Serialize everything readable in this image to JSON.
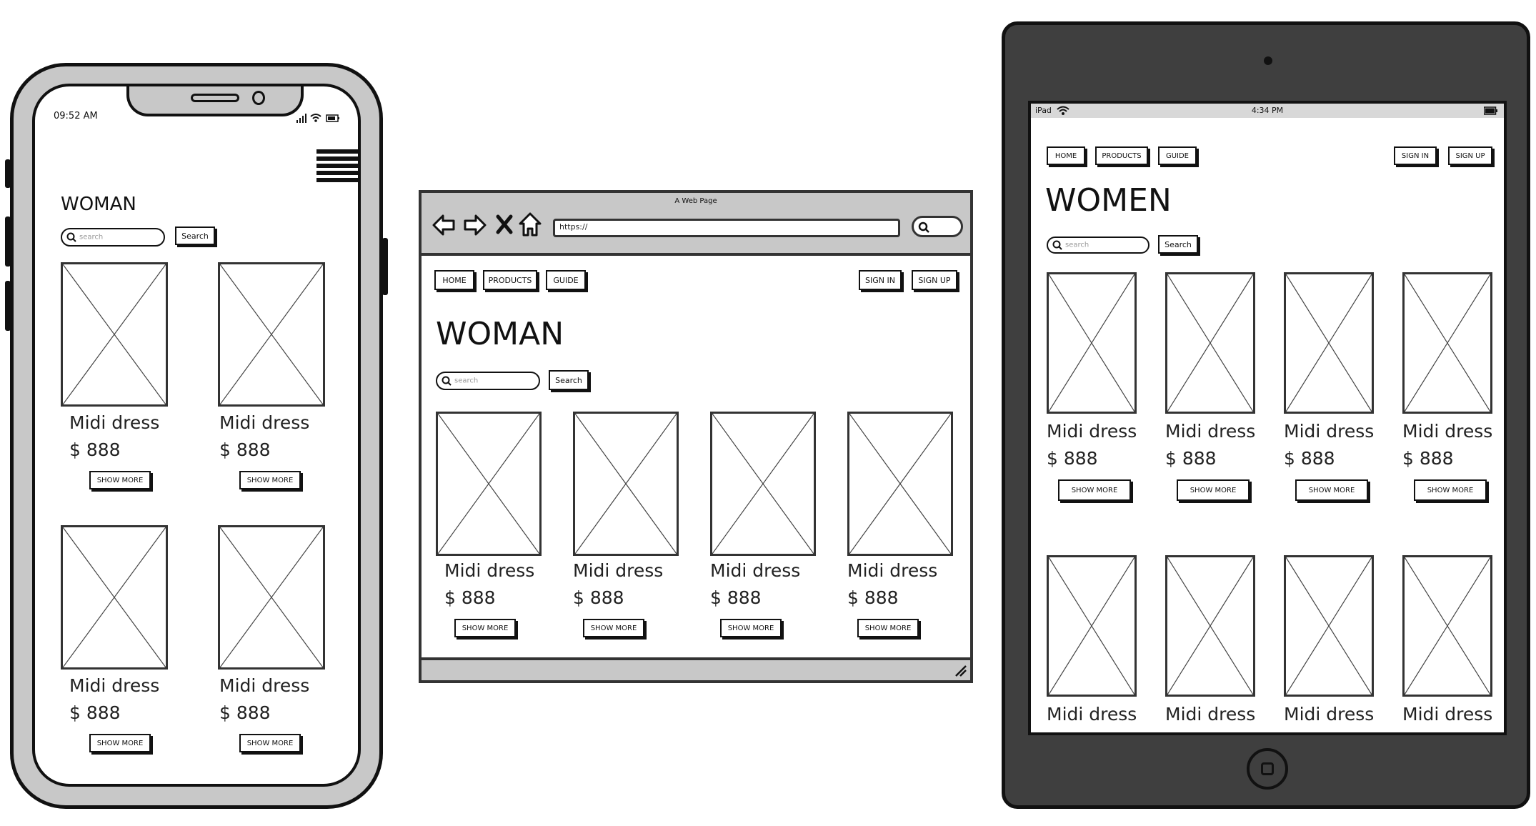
{
  "phone": {
    "time": "09:52 AM",
    "title": "WOMAN",
    "search_placeholder": "search",
    "search_button": "Search",
    "products": [
      {
        "name": "Midi dress",
        "price": "$ 888",
        "button": "SHOW MORE"
      },
      {
        "name": "Midi dress",
        "price": "$ 888",
        "button": "SHOW MORE"
      },
      {
        "name": "Midi dress",
        "price": "$ 888",
        "button": "SHOW MORE"
      },
      {
        "name": "Midi dress",
        "price": "$ 888",
        "button": "SHOW MORE"
      }
    ]
  },
  "browser": {
    "window_title": "A Web Page",
    "url": "https://",
    "nav": {
      "home": "HOME",
      "products": "PRODUCTS",
      "guide": "GUIDE",
      "sign_in": "SIGN IN",
      "sign_up": "SIGN UP"
    },
    "title": "WOMAN",
    "search_placeholder": "search",
    "search_button": "Search",
    "products": [
      {
        "name": "Midi dress",
        "price": "$ 888",
        "button": "SHOW MORE"
      },
      {
        "name": "Midi dress",
        "price": "$ 888",
        "button": "SHOW MORE"
      },
      {
        "name": "Midi dress",
        "price": "$ 888",
        "button": "SHOW MORE"
      },
      {
        "name": "Midi dress",
        "price": "$ 888",
        "button": "SHOW MORE"
      }
    ]
  },
  "tablet": {
    "carrier": "iPad",
    "time": "4:34 PM",
    "nav": {
      "home": "HOME",
      "products": "PRODUCTS",
      "guide": "GUIDE",
      "sign_in": "SIGN IN",
      "sign_up": "SIGN UP"
    },
    "title": "WOMEN",
    "search_placeholder": "search",
    "search_button": "Search",
    "products_row1": [
      {
        "name": "Midi dress",
        "price": "$ 888",
        "button": "SHOW MORE"
      },
      {
        "name": "Midi dress",
        "price": "$ 888",
        "button": "SHOW MORE"
      },
      {
        "name": "Midi dress",
        "price": "$ 888",
        "button": "SHOW MORE"
      },
      {
        "name": "Midi dress",
        "price": "$ 888",
        "button": "SHOW MORE"
      }
    ],
    "products_row2": [
      {
        "name": "Midi dress"
      },
      {
        "name": "Midi dress"
      },
      {
        "name": "Midi dress"
      },
      {
        "name": "Midi dress"
      }
    ]
  }
}
